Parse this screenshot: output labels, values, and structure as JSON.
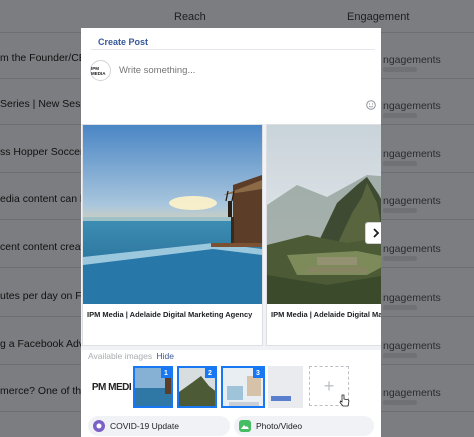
{
  "background": {
    "columns": {
      "reach": "Reach",
      "engagement": "Engagement"
    },
    "rows": [
      {
        "text": "m the Founder/CEO o",
        "engagement": "ngagements"
      },
      {
        "text": "Series | New Session!",
        "engagement": "ngagements"
      },
      {
        "text": "ss Hopper Soccer, it's",
        "engagement": "ngagements"
      },
      {
        "text": "edia content can be in",
        "engagement": "ngagements"
      },
      {
        "text": "cent content creation",
        "engagement": "ngagements"
      },
      {
        "text": "utes per day on Faceb",
        "engagement": "ngagements"
      },
      {
        "text": "g a Facebook Advert",
        "engagement": "ngagements"
      },
      {
        "text": "merce? One of the fi",
        "engagement": "ngagements"
      }
    ]
  },
  "modal": {
    "title": "Create Post",
    "avatar_text": "IPM MEDIA",
    "composer_placeholder": "Write something...",
    "carousel": {
      "cards": [
        {
          "caption": "IPM Media | Adelaide Digital Marketing Agency",
          "image": "sunset-pool-photo"
        },
        {
          "caption": "IPM Media | Adelaide Digital Marketing Agency",
          "image": "machu-picchu-photo"
        }
      ]
    },
    "available_images_label": "Available images",
    "hide_label": "Hide",
    "thumbnails": [
      {
        "badge": "1"
      },
      {
        "badge": "2"
      },
      {
        "badge": "3"
      }
    ],
    "logo_thumb_text": "PM MEDI",
    "add_label": "+",
    "actions": {
      "covid": "COVID-19 Update",
      "photo": "Photo/Video"
    }
  }
}
